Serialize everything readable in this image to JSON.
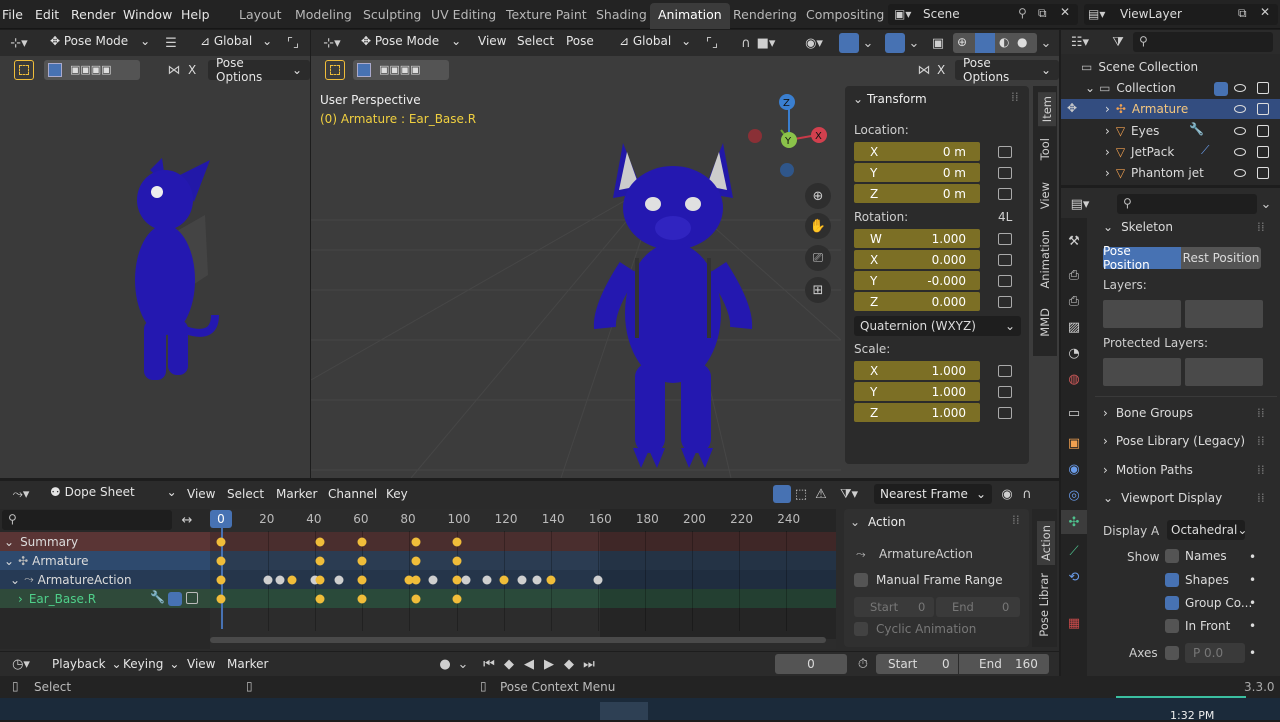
{
  "menu": [
    "File",
    "Edit",
    "Render",
    "Window",
    "Help"
  ],
  "workspaces": [
    "Layout",
    "Modeling",
    "Sculpting",
    "UV Editing",
    "Texture Paint",
    "Shading",
    "Animation",
    "Rendering",
    "Compositing"
  ],
  "active_workspace": "Animation",
  "scene": {
    "name": "Scene",
    "viewlayer": "ViewLayer"
  },
  "left_view": {
    "mode": "Pose Mode",
    "orientation": "Global",
    "pose_options": "Pose Options",
    "x_label": "X"
  },
  "main_view": {
    "mode": "Pose Mode",
    "menus": [
      "View",
      "Select",
      "Pose"
    ],
    "orientation": "Global",
    "pose_options": "Pose Options",
    "x_label": "X",
    "perspective": "User Perspective",
    "object_info": "(0) Armature : Ear_Base.R",
    "gizmo_axes": [
      "Z",
      "X",
      "Y"
    ]
  },
  "transform": {
    "title": "Transform",
    "location_label": "Location:",
    "location": [
      {
        "axis": "X",
        "value": "0 m"
      },
      {
        "axis": "Y",
        "value": "0 m"
      },
      {
        "axis": "Z",
        "value": "0 m"
      }
    ],
    "rotation_label": "Rotation:",
    "rotation_mode_short": "4L",
    "rotation": [
      {
        "axis": "W",
        "value": "1.000"
      },
      {
        "axis": "X",
        "value": "0.000"
      },
      {
        "axis": "Y",
        "value": "-0.000"
      },
      {
        "axis": "Z",
        "value": "0.000"
      }
    ],
    "rotation_mode": "Quaternion (WXYZ)",
    "scale_label": "Scale:",
    "scale": [
      {
        "axis": "X",
        "value": "1.000"
      },
      {
        "axis": "Y",
        "value": "1.000"
      },
      {
        "axis": "Z",
        "value": "1.000"
      }
    ]
  },
  "side_tabs": [
    "Item",
    "Tool",
    "View",
    "Animation",
    "MMD"
  ],
  "outliner": {
    "items": [
      "Scene Collection",
      "Collection",
      "Armature",
      "Eyes",
      "JetPack",
      "Phantom jet"
    ]
  },
  "properties": {
    "skeleton": "Skeleton",
    "pose_position": "Pose Position",
    "rest_position": "Rest Position",
    "layers": "Layers:",
    "protected_layers": "Protected Layers:",
    "sections": [
      "Bone Groups",
      "Pose Library (Legacy)",
      "Motion Paths",
      "Viewport Display"
    ],
    "display_as_label": "Display A",
    "display_as_value": "Octahedral",
    "show_label": "Show",
    "names": "Names",
    "shapes": "Shapes",
    "group_colors": "Group Co...",
    "in_front": "In Front",
    "axes": "Axes",
    "axes_value": "P 0.0"
  },
  "dopesheet": {
    "editor": "Dope Sheet",
    "menus": [
      "View",
      "Select",
      "Marker",
      "Channel",
      "Key"
    ],
    "snapping": "Nearest Frame",
    "frames": [
      "0",
      "20",
      "40",
      "60",
      "80",
      "100",
      "120",
      "140",
      "160",
      "180",
      "200",
      "220",
      "240"
    ],
    "channels": [
      "Summary",
      "Armature",
      "ArmatureAction",
      "Ear_Base.R"
    ],
    "action_panel": {
      "title": "Action",
      "action": "ArmatureAction",
      "manual_range": "Manual Frame Range",
      "start_label": "Start",
      "start": "0",
      "end_label": "End",
      "end": "0",
      "cyclic": "Cyclic Animation"
    },
    "tabs": [
      "Action",
      "Pose Librar"
    ]
  },
  "timeline": {
    "playback": "Playback",
    "keying": "Keying",
    "menus": [
      "View",
      "Marker"
    ],
    "current_frame": "0",
    "start_label": "Start",
    "start": "0",
    "end_label": "End",
    "end": "160"
  },
  "status": {
    "select": "Select",
    "context_menu": "Pose Context Menu",
    "version": "3.3.0"
  },
  "taskbar": {
    "time": "1:32 PM"
  }
}
